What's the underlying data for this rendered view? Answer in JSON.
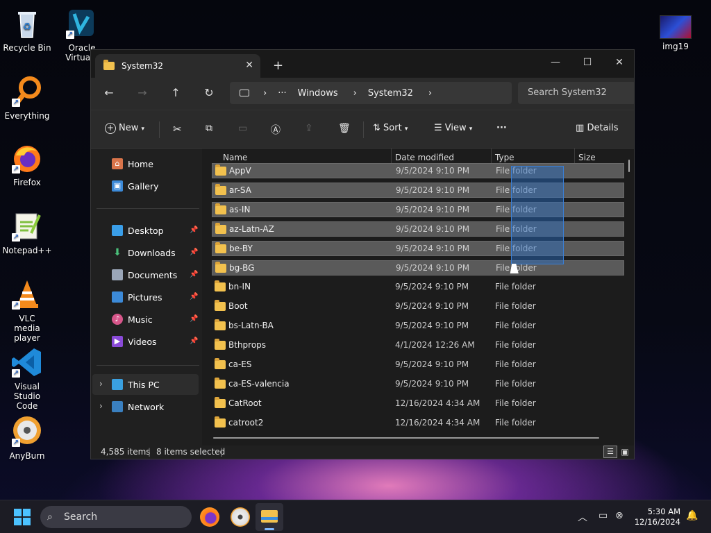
{
  "desktop": {
    "icons": [
      {
        "label": "Recycle Bin"
      },
      {
        "label": "Oracle VirtualB"
      },
      {
        "label": "Everything"
      },
      {
        "label": "Firefox"
      },
      {
        "label": "Notepad++"
      },
      {
        "label": "VLC media player"
      },
      {
        "label": "Visual Studio Code"
      },
      {
        "label": "AnyBurn"
      },
      {
        "label": "img19"
      }
    ]
  },
  "window": {
    "tab_title": "System32",
    "tab_close": "✕",
    "new_tab": "+",
    "controls": {
      "minimize": "—",
      "maximize": "☐",
      "close": "✕"
    },
    "nav": {
      "back": "←",
      "forward": "→",
      "up": "↑",
      "refresh": "↻"
    },
    "address": {
      "ellipsis": "···",
      "segments": [
        "Windows",
        "System32"
      ],
      "sep": "›"
    },
    "search_placeholder": "Search System32",
    "command_bar": {
      "new": "New",
      "sort": "Sort",
      "view": "View",
      "more": "···",
      "details": "Details"
    },
    "nav_pane": {
      "home": "Home",
      "gallery": "Gallery",
      "quick": [
        "Desktop",
        "Downloads",
        "Documents",
        "Pictures",
        "Music",
        "Videos"
      ],
      "this_pc": "This PC",
      "network": "Network"
    },
    "columns": {
      "name": "Name",
      "date": "Date modified",
      "type": "Type",
      "size": "Size"
    },
    "rows": [
      {
        "name": "AppV",
        "date": "9/5/2024 9:10 PM",
        "type": "File folder",
        "selected": true
      },
      {
        "name": "ar-SA",
        "date": "9/5/2024 9:10 PM",
        "type": "File folder",
        "selected": true
      },
      {
        "name": "as-IN",
        "date": "9/5/2024 9:10 PM",
        "type": "File folder",
        "selected": true
      },
      {
        "name": "az-Latn-AZ",
        "date": "9/5/2024 9:10 PM",
        "type": "File folder",
        "selected": true
      },
      {
        "name": "be-BY",
        "date": "9/5/2024 9:10 PM",
        "type": "File folder",
        "selected": true
      },
      {
        "name": "bg-BG",
        "date": "9/5/2024 9:10 PM",
        "type": "File folder",
        "selected": true
      },
      {
        "name": "bn-IN",
        "date": "9/5/2024 9:10 PM",
        "type": "File folder",
        "selected": false
      },
      {
        "name": "Boot",
        "date": "9/5/2024 9:10 PM",
        "type": "File folder",
        "selected": false
      },
      {
        "name": "bs-Latn-BA",
        "date": "9/5/2024 9:10 PM",
        "type": "File folder",
        "selected": false
      },
      {
        "name": "Bthprops",
        "date": "4/1/2024 12:26 AM",
        "type": "File folder",
        "selected": false
      },
      {
        "name": "ca-ES",
        "date": "9/5/2024 9:10 PM",
        "type": "File folder",
        "selected": false
      },
      {
        "name": "ca-ES-valencia",
        "date": "9/5/2024 9:10 PM",
        "type": "File folder",
        "selected": false
      },
      {
        "name": "CatRoot",
        "date": "12/16/2024 4:34 AM",
        "type": "File folder",
        "selected": false
      },
      {
        "name": "catroot2",
        "date": "12/16/2024 4:34 AM",
        "type": "File folder",
        "selected": false
      }
    ],
    "status": {
      "items": "4,585 items",
      "selected": "8 items selected"
    }
  },
  "taskbar": {
    "search": "Search",
    "time": "5:30 AM",
    "date": "12/16/2024"
  },
  "colors": {
    "folder": "#f2c14e",
    "accent": "#3a7fd6",
    "selection": "#5a5a5a"
  }
}
